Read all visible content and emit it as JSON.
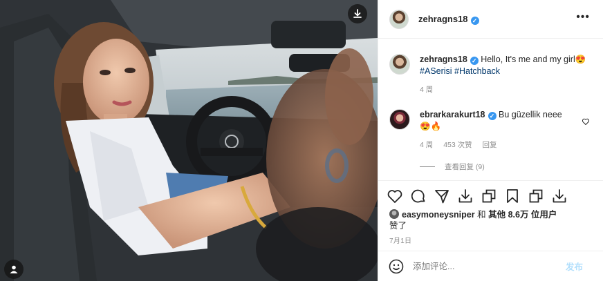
{
  "photo": {
    "download_icon": "download-icon",
    "user_tag_icon": "user-tag-icon"
  },
  "post": {
    "author": "zehragns18",
    "more_icon": "more-horizontal-icon",
    "more_glyph": "•••",
    "verified_glyph": "✓"
  },
  "caption": {
    "author": "zehragns18",
    "text_before": "Hello, It's me and my girl😍",
    "tags": [
      "#ASerisi",
      "#Hatchback"
    ],
    "time": "4 周"
  },
  "comments": [
    {
      "author": "ebrarkarakurt18",
      "text": "Bu güzellik neee 😍🔥",
      "time": "4 周",
      "likes": "453 次赞",
      "reply_label": "回复",
      "view_replies": "查看回复 (9)"
    }
  ],
  "actions": [
    "heart-icon",
    "comment-icon",
    "share-icon",
    "download-icon",
    "copy-icon",
    "bookmark-icon",
    "copy-icon",
    "download-icon"
  ],
  "likes": {
    "user": "easymoneysniper",
    "connector": "和",
    "others": "其他 8.6万 位用户",
    "suffix": "赞了"
  },
  "date": "7月1日",
  "add_comment": {
    "placeholder": "添加评论...",
    "post_label": "发布",
    "emoji_icon": "emoji-icon"
  },
  "colors": {
    "verified": "#3897f0",
    "hashtag": "#00376b",
    "muted": "#8e8e8e",
    "post_disabled": "#b2dffc"
  }
}
